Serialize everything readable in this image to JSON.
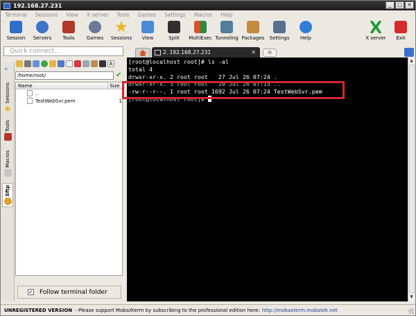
{
  "window": {
    "title": "192.168.27.231"
  },
  "menu": [
    "Terminal",
    "Sessions",
    "View",
    "X server",
    "Tools",
    "Games",
    "Settings",
    "Macros",
    "Help"
  ],
  "toolbar": {
    "items": [
      {
        "label": "Session",
        "icon": "session-icon",
        "color": "#2e6ec9"
      },
      {
        "label": "Servers",
        "icon": "servers-icon",
        "color": "#3b74c9"
      },
      {
        "label": "Tools",
        "icon": "tools-icon",
        "color": "#b3362a"
      },
      {
        "label": "Games",
        "icon": "games-icon",
        "color": "#6a7a99"
      },
      {
        "label": "Sessions",
        "icon": "sessions-star-icon",
        "color": "#e8b824"
      },
      {
        "label": "View",
        "icon": "view-icon",
        "color": "#4b8bd6"
      },
      {
        "label": "Split",
        "icon": "split-icon",
        "color": "#2f2f2f"
      },
      {
        "label": "MultiExec",
        "icon": "multiexec-icon",
        "color": "#d9532b"
      },
      {
        "label": "Tunneling",
        "icon": "tunneling-icon",
        "color": "#4f7f9d"
      },
      {
        "label": "Packages",
        "icon": "packages-icon",
        "color": "#c28a3d"
      },
      {
        "label": "Settings",
        "icon": "settings-icon",
        "color": "#5a6f8f"
      },
      {
        "label": "Help",
        "icon": "help-icon",
        "color": "#2f7ed8"
      }
    ],
    "right": [
      {
        "label": "X server",
        "icon": "xserver-icon",
        "color": "#1f9a3a"
      },
      {
        "label": "Exit",
        "icon": "exit-icon",
        "color": "#d62b2b"
      }
    ]
  },
  "quick_connect": {
    "placeholder": "Quick connect..."
  },
  "side_tabs": [
    {
      "label": "Sessions",
      "icon": "star-icon",
      "color": "#e8b824"
    },
    {
      "label": "Tools",
      "icon": "tools-icon",
      "color": "#b3362a"
    },
    {
      "label": "Macros",
      "icon": "macro-icon",
      "color": "#9a9a9a"
    },
    {
      "label": "Sftp",
      "icon": "sftp-icon",
      "color": "#e0a030"
    }
  ],
  "sftp": {
    "path": "/home/root/",
    "columns": {
      "name": "Name",
      "size": "Size"
    },
    "files": [
      {
        "name": "..",
        "size": ""
      },
      {
        "name": "TestWebSvr.pem",
        "size": "1"
      }
    ],
    "follow_label": "Follow terminal folder",
    "follow_checked": true
  },
  "terminal": {
    "tab_label": "2. 192.168.27.231",
    "lines": [
      "[root@localhost root]# ls -al",
      "total 4",
      "drwxr-xr-x. 2 root root   27 Jul 26 07:24 .",
      "drwxr-xr-x. 3 root root   20 Jul 26 07:15 ..",
      "-rw-r--r--. 1 root root 1692 Jul 26 07:24 TestWebSvr.pem",
      "[root@localhost root]# "
    ],
    "highlight_color": "#d3282a"
  },
  "statusbar": {
    "left": "UNREGISTERED VERSION",
    "middle": "-  Please support MobaXterm by subscribing to the professional edition here:",
    "link": "http://mobaxterm.mobatek.net"
  }
}
